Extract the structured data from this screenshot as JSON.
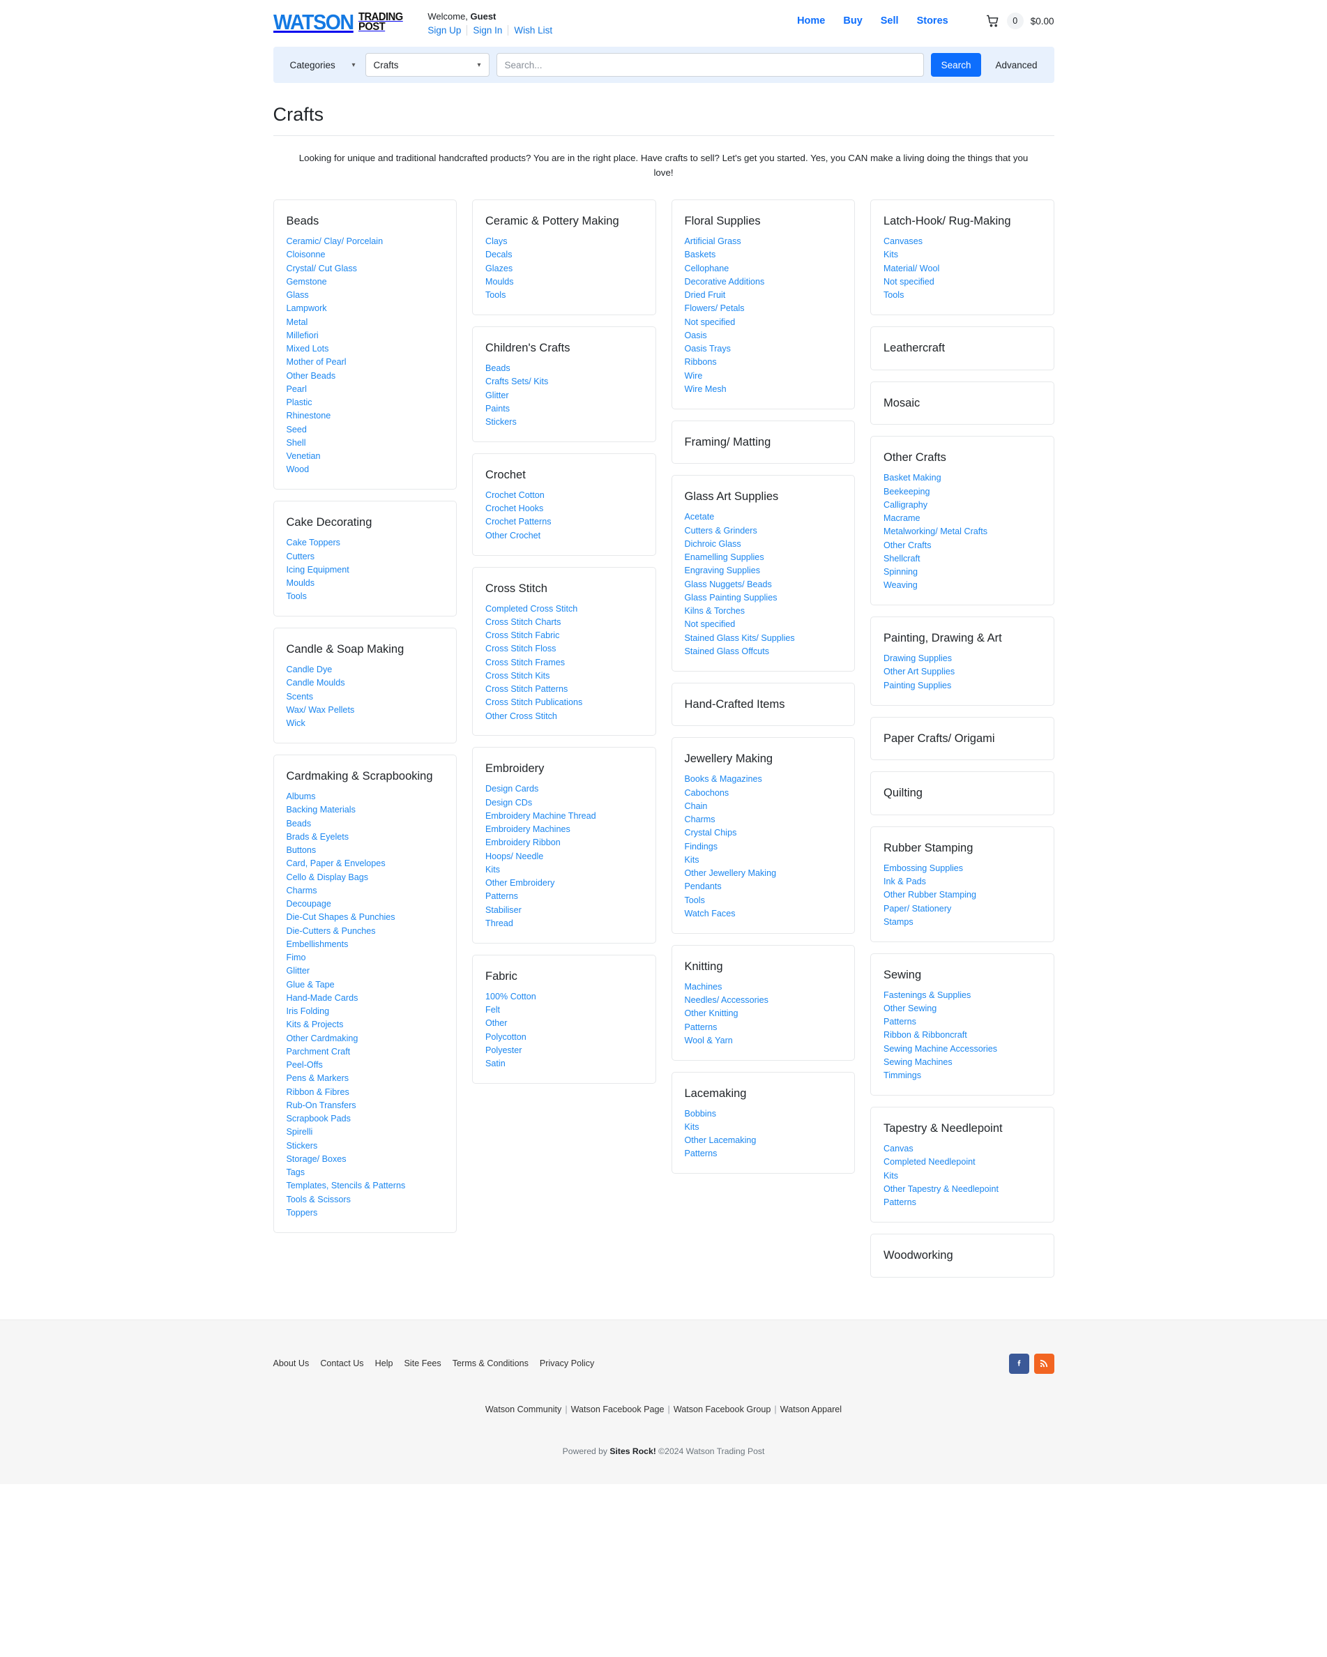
{
  "header": {
    "logo": {
      "watson": "WATSON",
      "trading": "TRADING",
      "post": "POST"
    },
    "welcome_prefix": "Welcome,",
    "welcome_user": "Guest",
    "account_links": [
      "Sign Up",
      "Sign In",
      "Wish List"
    ],
    "nav": [
      "Home",
      "Buy",
      "Sell",
      "Stores"
    ],
    "cart_count": "0",
    "cart_total": "$0.00"
  },
  "search": {
    "categories_label": "Categories",
    "selected_category": "Crafts",
    "placeholder": "Search...",
    "search_button": "Search",
    "advanced_label": "Advanced"
  },
  "page": {
    "title": "Crafts",
    "intro": "Looking for unique and traditional handcrafted products? You are in the right place. Have crafts to sell? Let's get you started. Yes, you CAN make a living doing the things that you love!"
  },
  "columns": [
    [
      {
        "title": "Beads",
        "links": [
          "Ceramic/ Clay/ Porcelain",
          "Cloisonne",
          "Crystal/ Cut Glass",
          "Gemstone",
          "Glass",
          "Lampwork",
          "Metal",
          "Millefiori",
          "Mixed Lots",
          "Mother of Pearl",
          "Other Beads",
          "Pearl",
          "Plastic",
          "Rhinestone",
          "Seed",
          "Shell",
          "Venetian",
          "Wood"
        ]
      },
      {
        "title": "Cake Decorating",
        "links": [
          "Cake Toppers",
          "Cutters",
          "Icing Equipment",
          "Moulds",
          "Tools"
        ]
      },
      {
        "title": "Candle & Soap Making",
        "links": [
          "Candle Dye",
          "Candle Moulds",
          "Scents",
          "Wax/ Wax Pellets",
          "Wick"
        ]
      },
      {
        "title": "Cardmaking & Scrapbooking",
        "links": [
          "Albums",
          "Backing Materials",
          "Beads",
          "Brads & Eyelets",
          "Buttons",
          "Card, Paper & Envelopes",
          "Cello & Display Bags",
          "Charms",
          "Decoupage",
          "Die-Cut Shapes & Punchies",
          "Die-Cutters & Punches",
          "Embellishments",
          "Fimo",
          "Glitter",
          "Glue & Tape",
          "Hand-Made Cards",
          "Iris Folding",
          "Kits & Projects",
          "Other Cardmaking",
          "Parchment Craft",
          "Peel-Offs",
          "Pens & Markers",
          "Ribbon & Fibres",
          "Rub-On Transfers",
          "Scrapbook Pads",
          "Spirelli",
          "Stickers",
          "Storage/ Boxes",
          "Tags",
          "Templates, Stencils & Patterns",
          "Tools & Scissors",
          "Toppers"
        ]
      }
    ],
    [
      {
        "title": "Ceramic & Pottery Making",
        "links": [
          "Clays",
          "Decals",
          "Glazes",
          "Moulds",
          "Tools"
        ]
      },
      {
        "title": "Children's Crafts",
        "links": [
          "Beads",
          "Crafts Sets/ Kits",
          "Glitter",
          "Paints",
          "Stickers"
        ]
      },
      {
        "title": "Crochet",
        "links": [
          "Crochet Cotton",
          "Crochet Hooks",
          "Crochet Patterns",
          "Other Crochet"
        ]
      },
      {
        "title": "Cross Stitch",
        "links": [
          "Completed Cross Stitch",
          "Cross Stitch Charts",
          "Cross Stitch Fabric",
          "Cross Stitch Floss",
          "Cross Stitch Frames",
          "Cross Stitch Kits",
          "Cross Stitch Patterns",
          "Cross Stitch Publications",
          "Other Cross Stitch"
        ]
      },
      {
        "title": "Embroidery",
        "links": [
          "Design Cards",
          "Design CDs",
          "Embroidery Machine Thread",
          "Embroidery Machines",
          "Embroidery Ribbon",
          "Hoops/ Needle",
          "Kits",
          "Other Embroidery",
          "Patterns",
          "Stabiliser",
          "Thread"
        ]
      },
      {
        "title": "Fabric",
        "links": [
          "100% Cotton",
          "Felt",
          "Other",
          "Polycotton",
          "Polyester",
          "Satin"
        ]
      }
    ],
    [
      {
        "title": "Floral Supplies",
        "links": [
          "Artificial Grass",
          "Baskets",
          "Cellophane",
          "Decorative Additions",
          "Dried Fruit",
          "Flowers/ Petals",
          "Not specified",
          "Oasis",
          "Oasis Trays",
          "Ribbons",
          "Wire",
          "Wire Mesh"
        ]
      },
      {
        "title": "Framing/ Matting",
        "links": []
      },
      {
        "title": "Glass Art Supplies",
        "links": [
          "Acetate",
          "Cutters & Grinders",
          "Dichroic Glass",
          "Enamelling Supplies",
          "Engraving Supplies",
          "Glass Nuggets/ Beads",
          "Glass Painting Supplies",
          "Kilns & Torches",
          "Not specified",
          "Stained Glass Kits/ Supplies",
          "Stained Glass Offcuts"
        ]
      },
      {
        "title": "Hand-Crafted Items",
        "links": []
      },
      {
        "title": "Jewellery Making",
        "links": [
          "Books & Magazines",
          "Cabochons",
          "Chain",
          "Charms",
          "Crystal Chips",
          "Findings",
          "Kits",
          "Other Jewellery Making",
          "Pendants",
          "Tools",
          "Watch Faces"
        ]
      },
      {
        "title": "Knitting",
        "links": [
          "Machines",
          "Needles/ Accessories",
          "Other Knitting",
          "Patterns",
          "Wool & Yarn"
        ]
      },
      {
        "title": "Lacemaking",
        "links": [
          "Bobbins",
          "Kits",
          "Other Lacemaking",
          "Patterns"
        ]
      }
    ],
    [
      {
        "title": "Latch-Hook/ Rug-Making",
        "links": [
          "Canvases",
          "Kits",
          "Material/ Wool",
          "Not specified",
          "Tools"
        ]
      },
      {
        "title": "Leathercraft",
        "links": []
      },
      {
        "title": "Mosaic",
        "links": []
      },
      {
        "title": "Other Crafts",
        "links": [
          "Basket Making",
          "Beekeeping",
          "Calligraphy",
          "Macrame",
          "Metalworking/ Metal Crafts",
          "Other Crafts",
          "Shellcraft",
          "Spinning",
          "Weaving"
        ]
      },
      {
        "title": "Painting, Drawing & Art",
        "links": [
          "Drawing Supplies",
          "Other Art Supplies",
          "Painting Supplies"
        ]
      },
      {
        "title": "Paper Crafts/ Origami",
        "links": []
      },
      {
        "title": "Quilting",
        "links": []
      },
      {
        "title": "Rubber Stamping",
        "links": [
          "Embossing Supplies",
          "Ink & Pads",
          "Other Rubber Stamping",
          "Paper/ Stationery",
          "Stamps"
        ]
      },
      {
        "title": "Sewing",
        "links": [
          "Fastenings & Supplies",
          "Other Sewing",
          "Patterns",
          "Ribbon & Ribboncraft",
          "Sewing Machine Accessories",
          "Sewing Machines",
          "Timmings"
        ]
      },
      {
        "title": "Tapestry & Needlepoint",
        "links": [
          "Canvas",
          "Completed Needlepoint",
          "Kits",
          "Other Tapestry & Needlepoint",
          "Patterns"
        ]
      },
      {
        "title": "Woodworking",
        "links": []
      }
    ]
  ],
  "footer": {
    "links": [
      "About Us",
      "Contact Us",
      "Help",
      "Site Fees",
      "Terms & Conditions",
      "Privacy Policy"
    ],
    "social": [
      "facebook-icon",
      "rss-icon"
    ],
    "mid_links": [
      "Watson Community",
      "Watson Facebook Page",
      "Watson Facebook Group",
      "Watson Apparel"
    ],
    "powered_prefix": "Powered by ",
    "powered_brand": "Sites Rock!",
    "copyright": " ©2024 Watson Trading Post"
  },
  "colors": {
    "accent": "#0d6efd",
    "link": "#1a86f0",
    "searchbar_bg": "#e8f1fd",
    "facebook": "#3b5998",
    "rss": "#f26522"
  }
}
